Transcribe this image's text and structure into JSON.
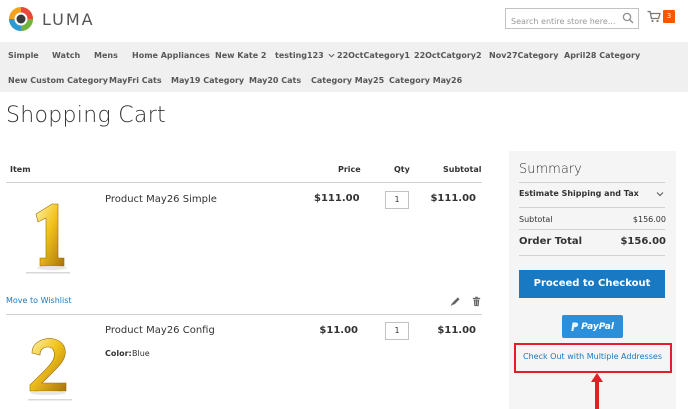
{
  "brand": {
    "name": "LUMA"
  },
  "search": {
    "placeholder": "Search entire store here..."
  },
  "cart": {
    "count": "3"
  },
  "nav": {
    "row1": [
      "Simple",
      "Watch",
      "Mens",
      "Home Appliances",
      "New Kate 2",
      "testing123",
      "22OctCategory1",
      "22OctCatgory2",
      "Nov27Category",
      "April28 Category"
    ],
    "row2": [
      "New Custom Category",
      "MayFri Cats",
      "May19 Category",
      "May20 Cats",
      "Category May25",
      "Category May26"
    ]
  },
  "page": {
    "title": "Shopping Cart"
  },
  "table": {
    "headers": {
      "item": "Item",
      "price": "Price",
      "qty": "Qty",
      "subtotal": "Subtotal"
    },
    "items": [
      {
        "name": "Product May26 Simple",
        "price": "$111.00",
        "qty": "1",
        "subtotal": "$111.00",
        "image_digit": "1",
        "move_to_wishlist": "Move to Wishlist"
      },
      {
        "name": "Product May26 Config",
        "price": "$11.00",
        "qty": "1",
        "subtotal": "$11.00",
        "image_digit": "2",
        "option_label": "Color:",
        "option_value": "Blue"
      }
    ]
  },
  "summary": {
    "title": "Summary",
    "estimate_label": "Estimate Shipping and Tax",
    "subtotal_label": "Subtotal",
    "subtotal_value": "$156.00",
    "order_total_label": "Order Total",
    "order_total_value": "$156.00",
    "checkout_label": "Proceed to Checkout",
    "paypal_label": "PayPal",
    "multi_address_label": "Check Out with Multiple Addresses"
  },
  "colors": {
    "primary": "#1979c3",
    "cart_badge": "#ff5501",
    "paypal": "#2c8fdb",
    "annotation": "#e41e26"
  }
}
